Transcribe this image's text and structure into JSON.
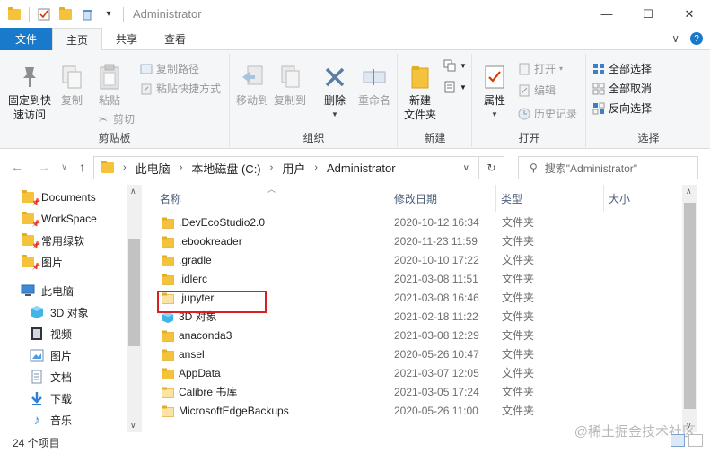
{
  "window": {
    "title": "Administrator",
    "controls": {
      "minimize": "—",
      "maximize": "☐",
      "close": "✕"
    }
  },
  "qat": {
    "dropdown": "▾"
  },
  "ribbon_tabs": [
    "文件",
    "主页",
    "共享",
    "查看"
  ],
  "ribbon_right": {
    "collapse": "∨",
    "help": "?"
  },
  "ribbon": {
    "clipboard": {
      "label": "剪贴板",
      "pin": "固定到快速访问",
      "copy": "复制",
      "paste": "粘贴",
      "copy_path": "复制路径",
      "paste_shortcut": "粘贴快捷方式",
      "cut": "剪切"
    },
    "organize": {
      "label": "组织",
      "move_to": "移动到",
      "copy_to": "复制到",
      "delete": "删除",
      "rename": "重命名"
    },
    "new": {
      "label": "新建",
      "new_folder": "新建\n文件夹"
    },
    "open": {
      "label": "打开",
      "properties": "属性",
      "open": "打开",
      "edit": "编辑",
      "history": "历史记录"
    },
    "select": {
      "label": "选择",
      "select_all": "全部选择",
      "select_none": "全部取消",
      "invert": "反向选择"
    }
  },
  "address": {
    "crumbs": [
      "此电脑",
      "本地磁盘 (C:)",
      "用户",
      "Administrator"
    ],
    "search_placeholder": "搜索\"Administrator\""
  },
  "nav_pane": {
    "items": [
      {
        "label": "Documents",
        "icon": "folder-icon",
        "pinned": true
      },
      {
        "label": "WorkSpace",
        "icon": "folder-icon",
        "pinned": true
      },
      {
        "label": "常用绿软",
        "icon": "folder-icon",
        "pinned": true
      },
      {
        "label": "图片",
        "icon": "folder-icon",
        "pinned": true
      },
      {
        "label": "此电脑",
        "icon": "computer-icon",
        "pinned": false
      },
      {
        "label": "3D 对象",
        "icon": "3d-objects-icon",
        "pinned": false
      },
      {
        "label": "视频",
        "icon": "video-icon",
        "pinned": false
      },
      {
        "label": "图片",
        "icon": "pictures-icon",
        "pinned": false
      },
      {
        "label": "文档",
        "icon": "documents-icon",
        "pinned": false
      },
      {
        "label": "下载",
        "icon": "download-icon",
        "pinned": false
      },
      {
        "label": "音乐",
        "icon": "music-icon",
        "pinned": false
      }
    ]
  },
  "columns": {
    "name": "名称",
    "date": "修改日期",
    "type": "类型",
    "size": "大小"
  },
  "files": [
    {
      "name": ".DevEcoStudio2.0",
      "date": "2020-10-12 16:34",
      "type": "文件夹",
      "icon": "folder-icon"
    },
    {
      "name": ".ebookreader",
      "date": "2020-11-23 11:59",
      "type": "文件夹",
      "icon": "folder-icon"
    },
    {
      "name": ".gradle",
      "date": "2020-10-10 17:22",
      "type": "文件夹",
      "icon": "folder-icon"
    },
    {
      "name": ".idlerc",
      "date": "2021-03-08 11:51",
      "type": "文件夹",
      "icon": "folder-icon"
    },
    {
      "name": ".jupyter",
      "date": "2021-03-08 16:46",
      "type": "文件夹",
      "icon": "folder-icon"
    },
    {
      "name": "3D 对象",
      "date": "2021-02-18 11:22",
      "type": "文件夹",
      "icon": "3d-objects-icon"
    },
    {
      "name": "anaconda3",
      "date": "2021-03-08 12:29",
      "type": "文件夹",
      "icon": "folder-icon"
    },
    {
      "name": "ansel",
      "date": "2020-05-26 10:47",
      "type": "文件夹",
      "icon": "folder-icon"
    },
    {
      "name": "AppData",
      "date": "2021-03-07 12:05",
      "type": "文件夹",
      "icon": "folder-icon"
    },
    {
      "name": "Calibre 书库",
      "date": "2021-03-05 17:24",
      "type": "文件夹",
      "icon": "folder-icon"
    },
    {
      "name": "MicrosoftEdgeBackups",
      "date": "2020-05-26 11:00",
      "type": "文件夹",
      "icon": "folder-icon"
    }
  ],
  "status": {
    "item_count": "24 个项目"
  },
  "watermark": "@稀土掘金技术社区",
  "colors": {
    "accent": "#1979ca",
    "folder": "#f5c33b",
    "highlight": "#d82020"
  }
}
